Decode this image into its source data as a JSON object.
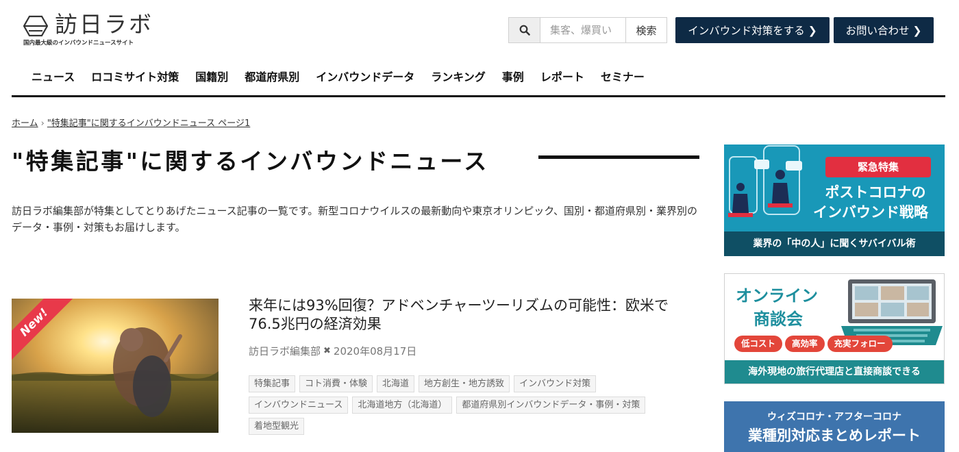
{
  "header": {
    "logo_text": "訪日ラボ",
    "logo_tagline": "国内最大級のインバウンドニュースサイト",
    "search_placeholder": "集客、爆買い",
    "search_submit": "検索",
    "cta_primary": "インバウンド対策をする ❯",
    "cta_contact": "お問い合わせ ❯"
  },
  "nav": {
    "items": [
      "ニュース",
      "ロコミサイト対策",
      "国籍別",
      "都道府県別",
      "インバウンドデータ",
      "ランキング",
      "事例",
      "レポート",
      "セミナー"
    ]
  },
  "breadcrumb": {
    "home": "ホーム",
    "separator": "›",
    "current": "\"特集記事\"に関するインバウンドニュース ページ1"
  },
  "page": {
    "title": "\"特集記事\"に関するインバウンドニュース",
    "intro": "訪日ラボ編集部が特集としてとりあげたニュース記事の一覧です。新型コロナウイルスの最新動向や東京オリンピック、国別・都道府県別・業界別のデータ・事例・対策もお届けします。"
  },
  "article": {
    "badge": "New!",
    "title": "来年には93%回復？アドベンチャーツーリズムの可能性：欧米で76.5兆円の経済効果",
    "author": "訪日ラボ編集部",
    "separator": "✖",
    "date": "2020年08月17日",
    "tags": [
      "特集記事",
      "コト消費・体験",
      "北海道",
      "地方創生・地方誘致",
      "インバウンド対策",
      "インバウンドニュース",
      "北海道地方（北海道）",
      "都道府県別インバウンドデータ・事例・対策",
      "着地型観光"
    ]
  },
  "banners": {
    "b1": {
      "badge": "緊急特集",
      "line1": "ポストコロナの",
      "line2": "インバウンド戦略",
      "caption": "業界の「中の人」に聞くサバイバル術"
    },
    "b2": {
      "title1": "オンライン",
      "title2": "商談会",
      "pills": [
        "低コスト",
        "高効率",
        "充実フォロー"
      ],
      "caption": "海外現地の旅行代理店と直接商談できる"
    },
    "b3": {
      "line1": "ウィズコロナ・アフターコロナ",
      "line2": "業種別対応まとめレポート"
    }
  },
  "colors": {
    "navy": "#0e2a45",
    "new_red": "#e8394a",
    "banner_teal": "#1998b8",
    "banner_green": "#1f8b8f",
    "banner_blue": "#3e74ad"
  }
}
